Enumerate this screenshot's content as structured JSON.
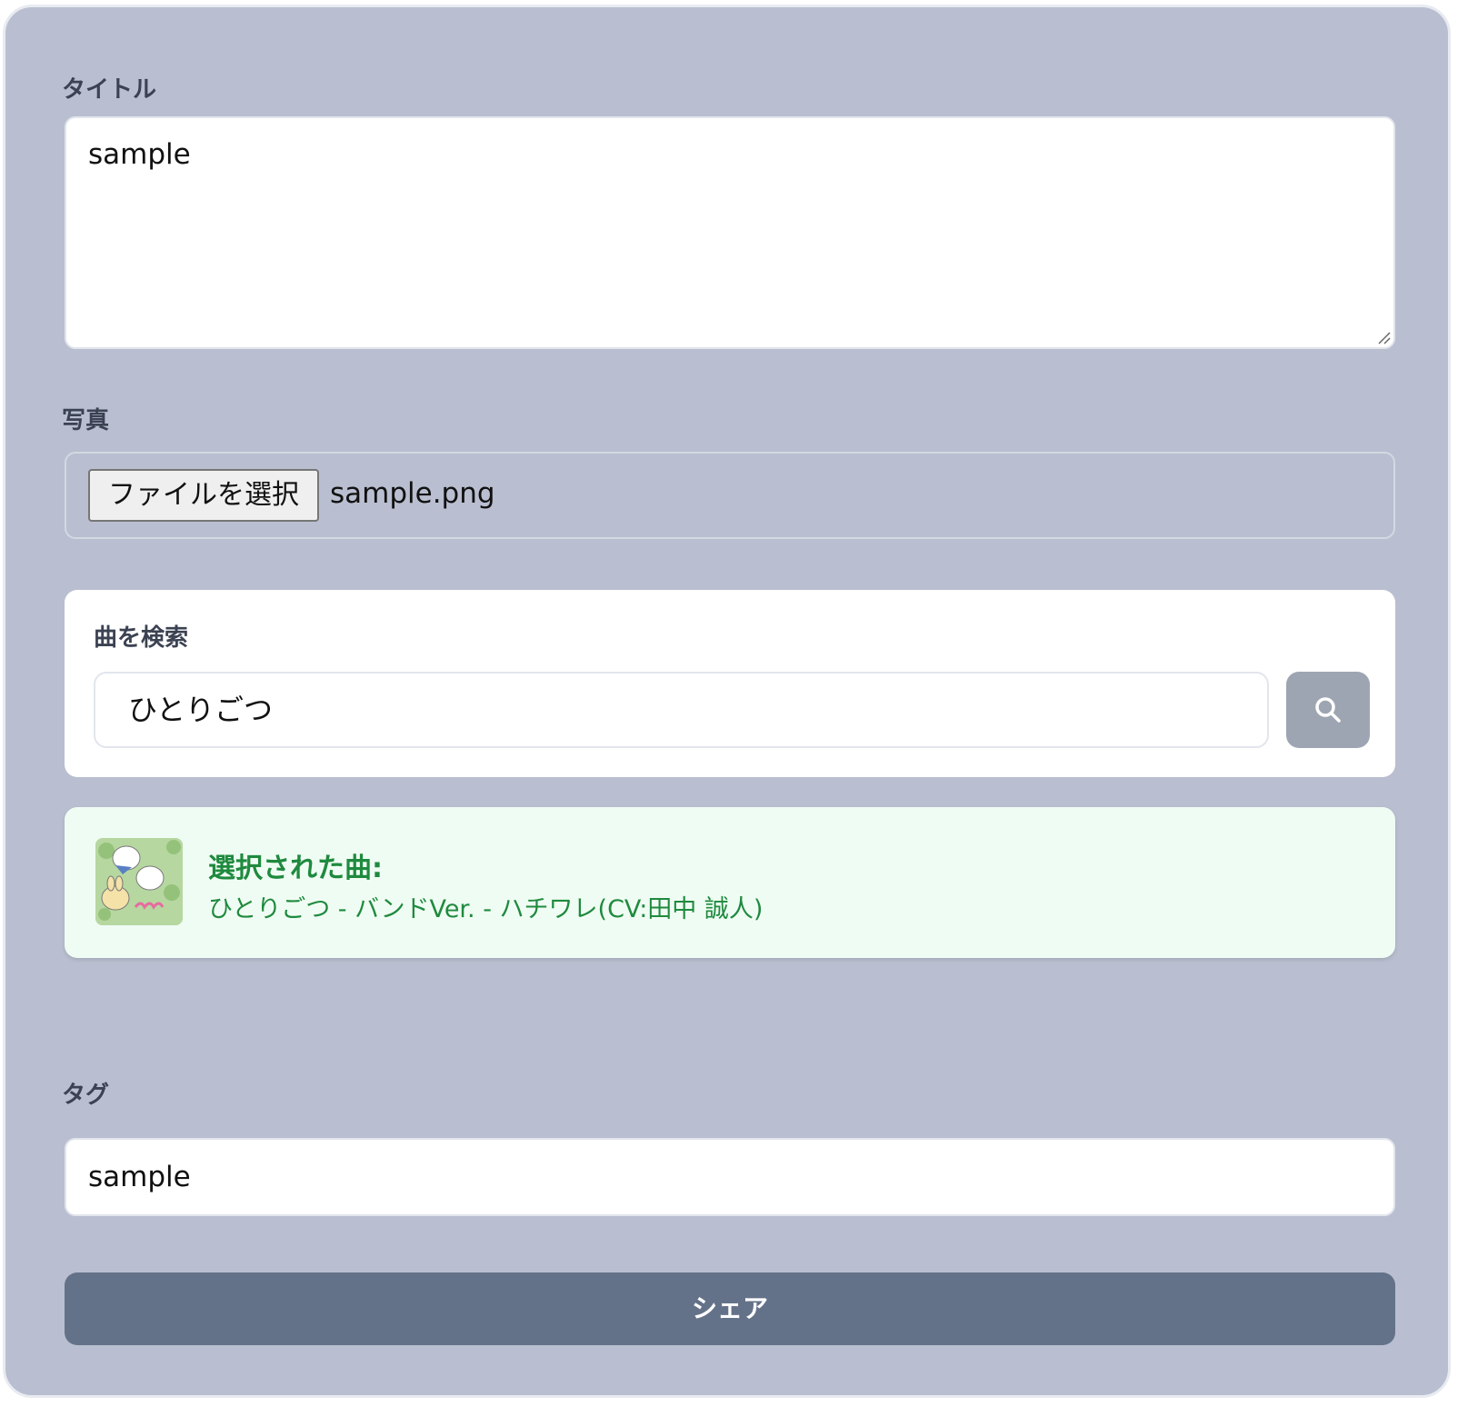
{
  "form": {
    "title_label": "タイトル",
    "title_value": "sample",
    "photo_label": "写真",
    "file_button_label": "ファイルを選択",
    "file_name": "sample.png",
    "search": {
      "label": "曲を検索",
      "value": "ひとりごつ",
      "button_icon": "search-icon"
    },
    "selected": {
      "title": "選択された曲:",
      "song": "ひとりごつ - バンドVer. - ハチワレ(CV:田中 誠人)",
      "thumbnail_icon": "album-art"
    },
    "tag_label": "タグ",
    "tag_value": "sample",
    "share_label": "シェア"
  },
  "colors": {
    "panel_bg": "#b9bfd0",
    "label": "#3b4252",
    "selected_bg": "#effcf3",
    "selected_text": "#1f8a3e",
    "share_bg": "#647289",
    "search_btn_bg": "#9ea5b2"
  }
}
